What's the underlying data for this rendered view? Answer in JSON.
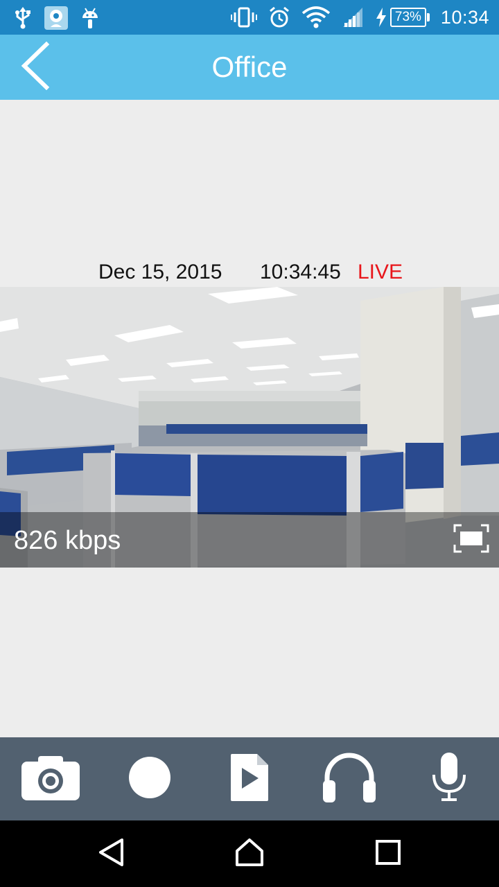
{
  "status_bar": {
    "left_icons": [
      "usb-icon",
      "camera-app-icon",
      "android-debug-icon"
    ],
    "right_icons": [
      "vibrate-icon",
      "alarm-icon",
      "wifi-icon",
      "signal-icon",
      "charging-icon"
    ],
    "battery": "73%",
    "time": "10:34"
  },
  "app_bar": {
    "title": "Office",
    "back_icon": "chevron-left-icon"
  },
  "stream": {
    "date": "Dec 15, 2015",
    "time": "10:34:45",
    "status": "LIVE",
    "bitrate": "826 kbps",
    "fullscreen_icon": "fullscreen-icon"
  },
  "toolbar": {
    "buttons": [
      "camera-icon",
      "record-icon",
      "playback-icon",
      "headphones-icon",
      "microphone-icon"
    ]
  },
  "nav_bar": {
    "buttons": [
      "back-icon",
      "home-icon",
      "recents-icon"
    ]
  },
  "colors": {
    "status_bar": "#1e86c4",
    "app_bar": "#5bc0ea",
    "live": "#e8161b",
    "toolbar": "#526170",
    "background": "#ededed"
  }
}
